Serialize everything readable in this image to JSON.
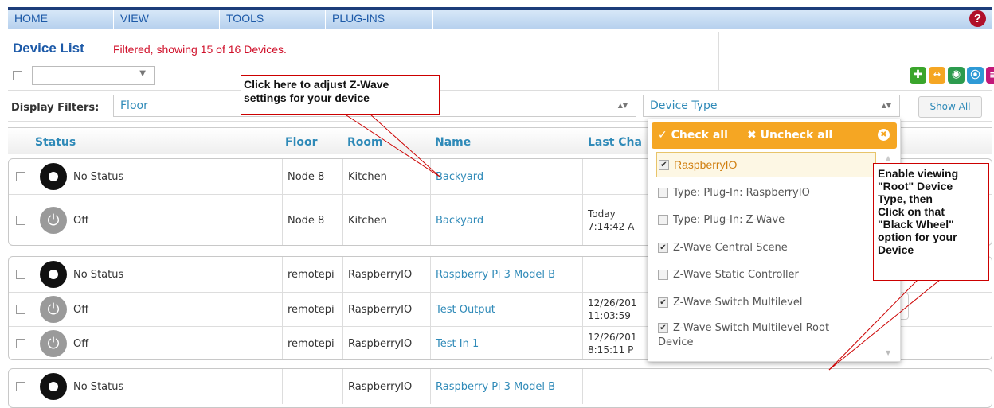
{
  "nav": {
    "items": [
      "HOME",
      "VIEW",
      "TOOLS",
      "PLUG-INS"
    ],
    "help_glyph": "?"
  },
  "header": {
    "title": "Device List",
    "filter_status": "Filtered, showing 15 of 16 Devices."
  },
  "toolbar": {
    "action_select_value": "",
    "icons": [
      "add-icon",
      "link-icon",
      "eye-icon",
      "broadcast-icon",
      "list-icon"
    ],
    "icon_colors": {
      "add": "#3aa52b",
      "link": "#f5a623",
      "eye": "#2c9b4e",
      "broadcast": "#2e9ad6",
      "list": "#c2187a"
    }
  },
  "filters": {
    "label": "Display Filters:",
    "floor": "Floor",
    "device_type": "Device Type",
    "show_all": "Show All"
  },
  "columns": {
    "status": "Status",
    "floor": "Floor",
    "room": "Room",
    "name": "Name",
    "last_change": "Last Cha"
  },
  "groups": [
    {
      "rows": [
        {
          "icon": "wheel",
          "status": "No Status",
          "floor": "Node 8",
          "room": "Kitchen",
          "name": "Backyard",
          "last_change": [
            "",
            ""
          ]
        },
        {
          "icon": "power",
          "status": "Off",
          "floor": "Node 8",
          "room": "Kitchen",
          "name": "Backyard",
          "last_change": [
            "Today",
            "7:14:42 A"
          ]
        }
      ]
    },
    {
      "rows": [
        {
          "icon": "wheel",
          "status": "No Status",
          "floor": "remotepi",
          "room": "RaspberryIO",
          "name": "Raspberry Pi 3 Model B",
          "last_change": [
            "",
            ""
          ]
        },
        {
          "icon": "power",
          "status": "Off",
          "floor": "remotepi",
          "room": "RaspberryIO",
          "name": "Test Output",
          "last_change": [
            "12/26/201",
            "11:03:59"
          ]
        },
        {
          "icon": "power",
          "status": "Off",
          "floor": "remotepi",
          "room": "RaspberryIO",
          "name": "Test In 1",
          "last_change": [
            "12/26/201",
            "8:15:11 P"
          ]
        }
      ]
    },
    {
      "rows": [
        {
          "icon": "wheel",
          "status": "No Status",
          "floor": "",
          "room": "RaspberryIO",
          "name": "Raspberry Pi 3 Model B",
          "last_change": [
            "",
            ""
          ]
        }
      ]
    }
  ],
  "dropdown": {
    "check_all": "Check all",
    "uncheck_all": "Uncheck all",
    "options": [
      {
        "label": "RaspberryIO",
        "checked": true
      },
      {
        "label": "Type: Plug-In: RaspberryIO",
        "checked": false
      },
      {
        "label": "Type: Plug-In: Z-Wave",
        "checked": false
      },
      {
        "label": "Z-Wave Central Scene",
        "checked": true
      },
      {
        "label": "Z-Wave Static Controller",
        "checked": false
      },
      {
        "label": "Z-Wave Switch Multilevel",
        "checked": true
      },
      {
        "label": "Z-Wave Switch Multilevel Root",
        "checked": true,
        "label_cont": "Device"
      }
    ]
  },
  "callouts": {
    "zwave": [
      "Click here to adjust Z-Wave",
      "settings for your device"
    ],
    "root": [
      "Enable viewing",
      "\"Root\" Device",
      "Type, then",
      "Click on that",
      "\"Black Wheel\"",
      "option for your",
      "Device"
    ]
  }
}
